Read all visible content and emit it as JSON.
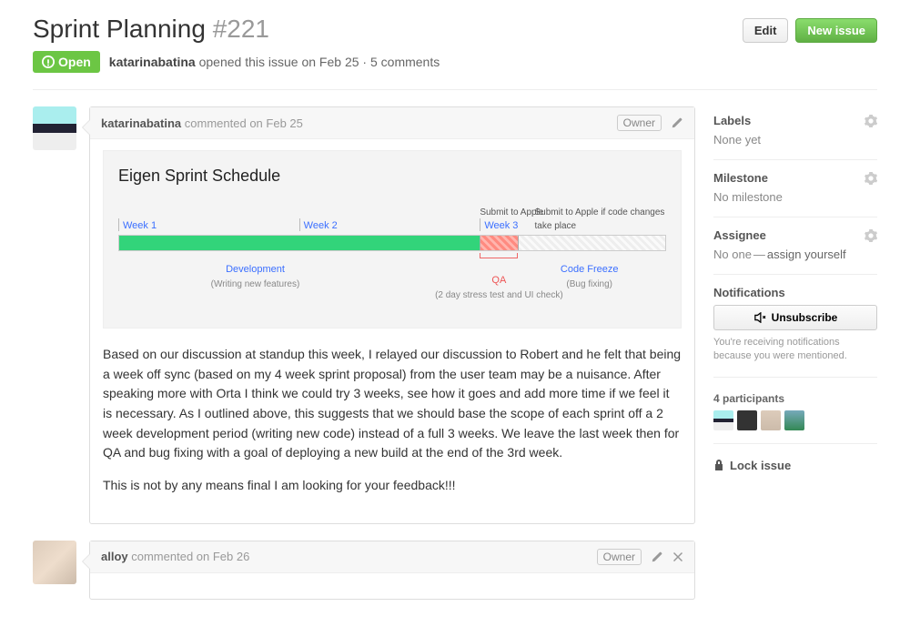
{
  "header": {
    "title": "Sprint Planning",
    "number": "#221",
    "edit_label": "Edit",
    "new_issue_label": "New issue"
  },
  "meta": {
    "state": "Open",
    "author": "katarinabatina",
    "verb": "opened this issue",
    "date": "on Feb 25",
    "separator": "·",
    "comments": "5 comments"
  },
  "comments": [
    {
      "author": "katarinabatina",
      "verb": "commented",
      "date": "on Feb 25",
      "owner_label": "Owner",
      "schedule": {
        "title": "Eigen Sprint Schedule",
        "top_labels": {
          "submit": "Submit to Apple",
          "submit2": "Submit to Apple if code changes take place"
        },
        "weeks": {
          "w1": "Week 1",
          "w2": "Week 2",
          "w3": "Week 3"
        },
        "below": {
          "dev": "Development",
          "dev_sub": "(Writing new features)",
          "qa": "QA",
          "qa_sub": "(2 day stress test and UI check)",
          "freeze": "Code Freeze",
          "freeze_sub": "(Bug fixing)"
        }
      },
      "body_p1": "Based on our discussion at standup this week, I relayed our discussion to Robert and he felt that being a week off sync (based on my 4 week sprint proposal) from the user team may be a nuisance. After speaking more with Orta I think we could try 3 weeks, see how it goes and add more time if we feel it is necessary. As I outlined above, this suggests that we should base the scope of each sprint off a 2 week development period (writing new code) instead of a full 3 weeks. We leave the last week then for QA and bug fixing with a goal of deploying a new build at the end of the 3rd week.",
      "body_p2": "This is not by any means final I am looking for your feedback!!!"
    },
    {
      "author": "alloy",
      "verb": "commented",
      "date": "on Feb 26",
      "owner_label": "Owner"
    }
  ],
  "sidebar": {
    "labels": {
      "title": "Labels",
      "value": "None yet"
    },
    "milestone": {
      "title": "Milestone",
      "value": "No milestone"
    },
    "assignee": {
      "title": "Assignee",
      "value_prefix": "No one",
      "dash": "—",
      "link": "assign yourself"
    },
    "notifications": {
      "title": "Notifications",
      "button": "Unsubscribe",
      "note": "You're receiving notifications because you were mentioned."
    },
    "participants": {
      "title": "4 participants"
    },
    "lock": {
      "label": "Lock issue"
    }
  },
  "chart_data": {
    "type": "bar",
    "title": "Eigen Sprint Schedule",
    "categories": [
      "Week 1",
      "Week 2",
      "Week 3"
    ],
    "segments": [
      {
        "name": "Development",
        "note": "Writing new features",
        "weeks": 2.0,
        "percent": 66
      },
      {
        "name": "QA",
        "note": "2 day stress test and UI check",
        "weeks": 0.3,
        "percent": 7
      },
      {
        "name": "Code Freeze",
        "note": "Bug fixing",
        "weeks": 0.7,
        "percent": 27
      }
    ],
    "annotations": [
      "Submit to Apple",
      "Submit to Apple if code changes take place"
    ]
  }
}
